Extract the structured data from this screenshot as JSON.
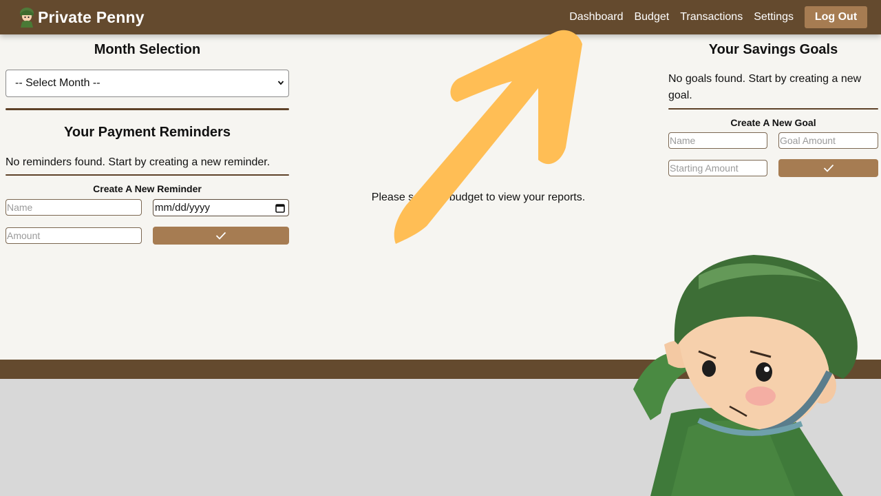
{
  "app": {
    "brand_name": "Private Penny",
    "brand_logo": "soldier-logo-icon"
  },
  "nav": {
    "links": [
      "Dashboard",
      "Budget",
      "Transactions",
      "Settings"
    ],
    "logout_label": "Log Out"
  },
  "month_selection": {
    "title": "Month Selection",
    "select_value": "-- Select Month --"
  },
  "reminders": {
    "title": "Your Payment Reminders",
    "empty_text": "No reminders found. Start by creating a new reminder.",
    "form_title": "Create A New Reminder",
    "name_placeholder": "Name",
    "date_placeholder": "mm/dd/yyyy",
    "amount_placeholder": "Amount",
    "submit_icon": "checkmark-icon"
  },
  "center": {
    "message": "Please select a budget to view your reports."
  },
  "goals": {
    "title": "Your Savings Goals",
    "empty_text": "No goals found. Start by creating a new goal.",
    "form_title": "Create A New Goal",
    "name_placeholder": "Name",
    "goal_amount_placeholder": "Goal Amount",
    "starting_amount_placeholder": "Starting Amount",
    "submit_icon": "checkmark-icon"
  },
  "colors": {
    "navbar": "#644a2e",
    "accent_button": "#a67c52",
    "page_background": "#f6f5f1",
    "arrow_annotation": "#ffbe55"
  }
}
